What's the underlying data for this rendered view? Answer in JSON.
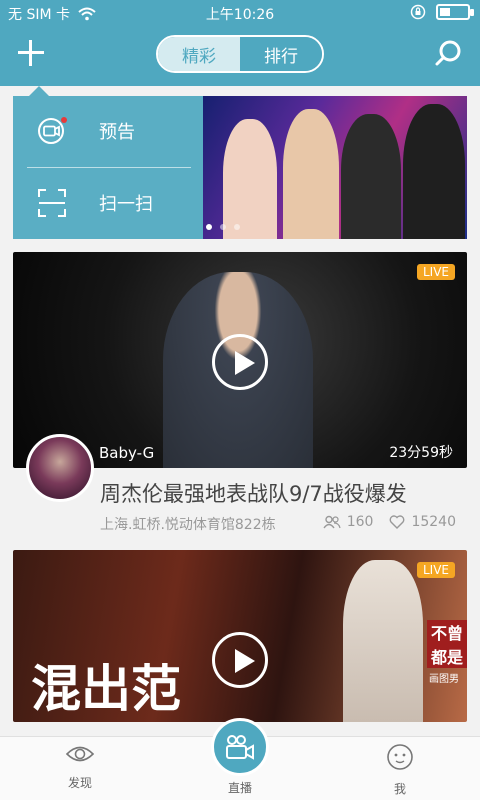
{
  "status_bar": {
    "carrier": "无 SIM 卡",
    "time": "上午10:26"
  },
  "top_bar": {
    "tabs": [
      {
        "label": "精彩",
        "active": true
      },
      {
        "label": "排行",
        "active": false
      }
    ]
  },
  "menu": {
    "items": [
      {
        "label": "预告",
        "icon": "video-camera-icon"
      },
      {
        "label": "扫一扫",
        "icon": "scan-icon"
      }
    ]
  },
  "banner": {
    "page_count": 3,
    "active_index": 0
  },
  "feed": [
    {
      "badge": "LIVE",
      "host_name": "Baby-G",
      "duration": "23分59秒",
      "title": "周杰伦最强地表战队9/7战役爆发",
      "location": "上海.虹桥.悦动体育馆822栋",
      "viewers": "160",
      "likes": "15240"
    },
    {
      "badge": "LIVE",
      "overlay_text": "混出范",
      "side_text_1": "不曾",
      "side_text_2": "都是",
      "side_text_3": "画图男"
    }
  ],
  "bottom_nav": {
    "discover": "发现",
    "live": "直播",
    "me": "我"
  },
  "colors": {
    "accent": "#4fa8c0",
    "live_badge": "#f5a623"
  }
}
